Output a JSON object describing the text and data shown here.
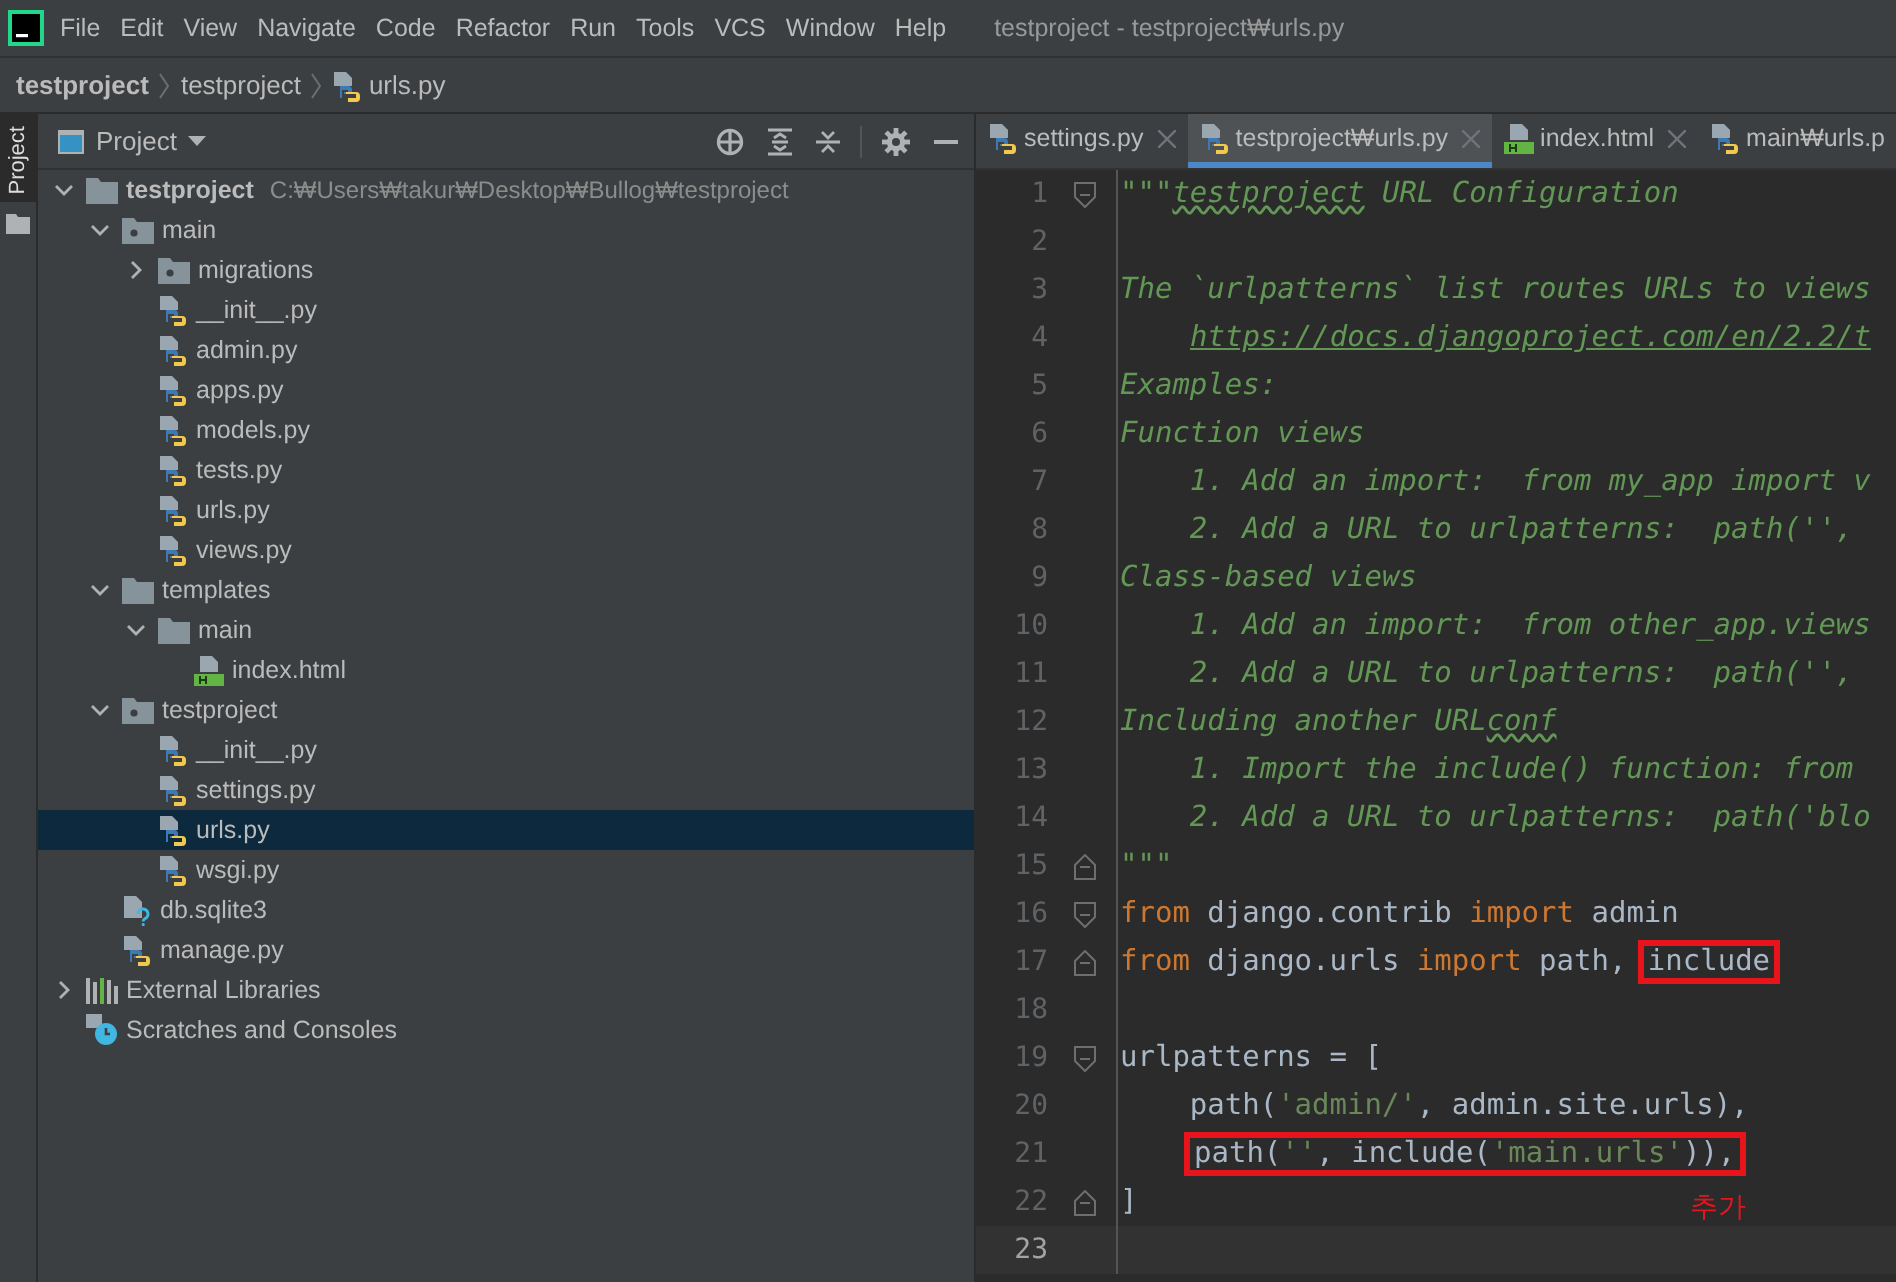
{
  "window": {
    "title": "testproject - testproject₩urls.py"
  },
  "menu": [
    "File",
    "Edit",
    "View",
    "Navigate",
    "Code",
    "Refactor",
    "Run",
    "Tools",
    "VCS",
    "Window",
    "Help"
  ],
  "breadcrumb": [
    {
      "label": "testproject",
      "kind": "project"
    },
    {
      "label": "testproject",
      "kind": "folder"
    },
    {
      "label": "urls.py",
      "kind": "python"
    }
  ],
  "side_strip": {
    "label": "Project"
  },
  "project": {
    "title": "Project",
    "tree": [
      {
        "label": "testproject",
        "path": "C:₩Users₩takur₩Desktop₩Bullog₩testproject",
        "kind": "folder",
        "expanded": true,
        "selected": false,
        "children": [
          {
            "label": "main",
            "kind": "package",
            "expanded": true,
            "selected": false,
            "children": [
              {
                "label": "migrations",
                "kind": "package",
                "expanded": false,
                "selected": false
              },
              {
                "label": "__init__.py",
                "kind": "python",
                "selected": false
              },
              {
                "label": "admin.py",
                "kind": "python",
                "selected": false
              },
              {
                "label": "apps.py",
                "kind": "python",
                "selected": false
              },
              {
                "label": "models.py",
                "kind": "python",
                "selected": false
              },
              {
                "label": "tests.py",
                "kind": "python",
                "selected": false
              },
              {
                "label": "urls.py",
                "kind": "python",
                "selected": false
              },
              {
                "label": "views.py",
                "kind": "python",
                "selected": false
              }
            ]
          },
          {
            "label": "templates",
            "kind": "folder",
            "expanded": true,
            "selected": false,
            "children": [
              {
                "label": "main",
                "kind": "folder",
                "expanded": true,
                "selected": false,
                "children": [
                  {
                    "label": "index.html",
                    "kind": "html",
                    "selected": false
                  }
                ]
              }
            ]
          },
          {
            "label": "testproject",
            "kind": "package",
            "expanded": true,
            "selected": false,
            "children": [
              {
                "label": "__init__.py",
                "kind": "python",
                "selected": false
              },
              {
                "label": "settings.py",
                "kind": "python",
                "selected": false
              },
              {
                "label": "urls.py",
                "kind": "python",
                "selected": true
              },
              {
                "label": "wsgi.py",
                "kind": "python",
                "selected": false
              }
            ]
          },
          {
            "label": "db.sqlite3",
            "kind": "unknown",
            "selected": false
          },
          {
            "label": "manage.py",
            "kind": "python",
            "selected": false
          }
        ]
      },
      {
        "label": "External Libraries",
        "kind": "libraries",
        "expanded": false,
        "selected": false
      },
      {
        "label": "Scratches and Consoles",
        "kind": "scratches",
        "selected": false
      }
    ]
  },
  "editor": {
    "tabs": [
      {
        "label": "settings.py",
        "kind": "python",
        "selected": false
      },
      {
        "label": "testproject₩urls.py",
        "kind": "python",
        "selected": true
      },
      {
        "label": "index.html",
        "kind": "html",
        "selected": false
      },
      {
        "label": "main₩urls.p",
        "kind": "python",
        "selected": false
      }
    ],
    "lines": [
      {
        "number": "1",
        "fold_start": true,
        "current": false,
        "tokens": [
          {
            "text": "\"\"\"",
            "kind": "doc"
          },
          {
            "text": "testproject",
            "kind": "doc-typo"
          },
          {
            "text": " URL Configuration",
            "kind": "doc"
          }
        ]
      },
      {
        "number": "2",
        "current": false
      },
      {
        "number": "3",
        "current": false,
        "tokens": [
          {
            "text": "The `urlpatterns` list routes URLs to views",
            "kind": "doc"
          }
        ]
      },
      {
        "number": "4",
        "indented": true,
        "current": false,
        "tokens": [
          {
            "text": "https://docs.djangoproject.com/en/2.2/t",
            "kind": "link"
          }
        ]
      },
      {
        "number": "5",
        "current": false,
        "tokens": [
          {
            "text": "Examples:",
            "kind": "doc"
          }
        ]
      },
      {
        "number": "6",
        "current": false,
        "tokens": [
          {
            "text": "Function views",
            "kind": "doc"
          }
        ]
      },
      {
        "number": "7",
        "current": false,
        "tokens": [
          {
            "text": "    1. Add an import:  from my_app import v",
            "kind": "doc"
          }
        ]
      },
      {
        "number": "8",
        "current": false,
        "tokens": [
          {
            "text": "    2. Add a URL to urlpatterns:  path('',",
            "kind": "doc"
          }
        ]
      },
      {
        "number": "9",
        "current": false,
        "tokens": [
          {
            "text": "Class-based views",
            "kind": "doc"
          }
        ]
      },
      {
        "number": "10",
        "current": false,
        "tokens": [
          {
            "text": "    1. Add an import:  from other_app.views",
            "kind": "doc"
          }
        ]
      },
      {
        "number": "11",
        "current": false,
        "tokens": [
          {
            "text": "    2. Add a URL to urlpatterns:  path('',",
            "kind": "doc"
          }
        ]
      },
      {
        "number": "12",
        "current": false,
        "tokens": [
          {
            "text": "Including another URL",
            "kind": "doc"
          },
          {
            "text": "conf",
            "kind": "doc-typo"
          }
        ]
      },
      {
        "number": "13",
        "current": false,
        "tokens": [
          {
            "text": "    1. Import the include() function: from",
            "kind": "doc"
          }
        ]
      },
      {
        "number": "14",
        "current": false,
        "tokens": [
          {
            "text": "    2. Add a URL to urlpatterns:  path('blo",
            "kind": "doc"
          }
        ]
      },
      {
        "number": "15",
        "fold_end": true,
        "current": false,
        "tokens": [
          {
            "text": "\"\"\"",
            "kind": "doc"
          }
        ]
      },
      {
        "number": "16",
        "fold_start": true,
        "current": false,
        "tokens": [
          {
            "text": "from",
            "kind": "keyword"
          },
          {
            "text": " django.contrib ",
            "kind": "plain"
          },
          {
            "text": "import",
            "kind": "keyword"
          },
          {
            "text": " admin",
            "kind": "plain"
          }
        ]
      },
      {
        "number": "17",
        "fold_end": true,
        "current": false,
        "tokens": [
          {
            "text": "from",
            "kind": "keyword"
          },
          {
            "text": " django.urls ",
            "kind": "plain"
          },
          {
            "text": "import",
            "kind": "keyword"
          },
          {
            "text": " path, ",
            "kind": "plain"
          }
        ],
        "boxed": [
          {
            "text": "include",
            "kind": "plain"
          }
        ]
      },
      {
        "number": "18",
        "current": false
      },
      {
        "number": "19",
        "fold_start": true,
        "current": false,
        "tokens": [
          {
            "text": "urlpatterns = [",
            "kind": "plain"
          }
        ]
      },
      {
        "number": "20",
        "current": false,
        "tokens": [
          {
            "text": "    path(",
            "kind": "plain"
          },
          {
            "text": "'admin/'",
            "kind": "string"
          },
          {
            "text": ", admin.site.urls),",
            "kind": "plain"
          }
        ]
      },
      {
        "number": "21",
        "indented": true,
        "current": false,
        "boxed": [
          {
            "text": "path(",
            "kind": "plain"
          },
          {
            "text": "''",
            "kind": "string"
          },
          {
            "text": ", include(",
            "kind": "plain"
          },
          {
            "text": "'main.urls'",
            "kind": "string"
          },
          {
            "text": ")),",
            "kind": "plain"
          }
        ]
      },
      {
        "number": "22",
        "fold_end": true,
        "current": false,
        "tokens": [
          {
            "text": "]",
            "kind": "plain"
          }
        ]
      },
      {
        "number": "23",
        "current": true
      }
    ],
    "annotation": "추가"
  }
}
